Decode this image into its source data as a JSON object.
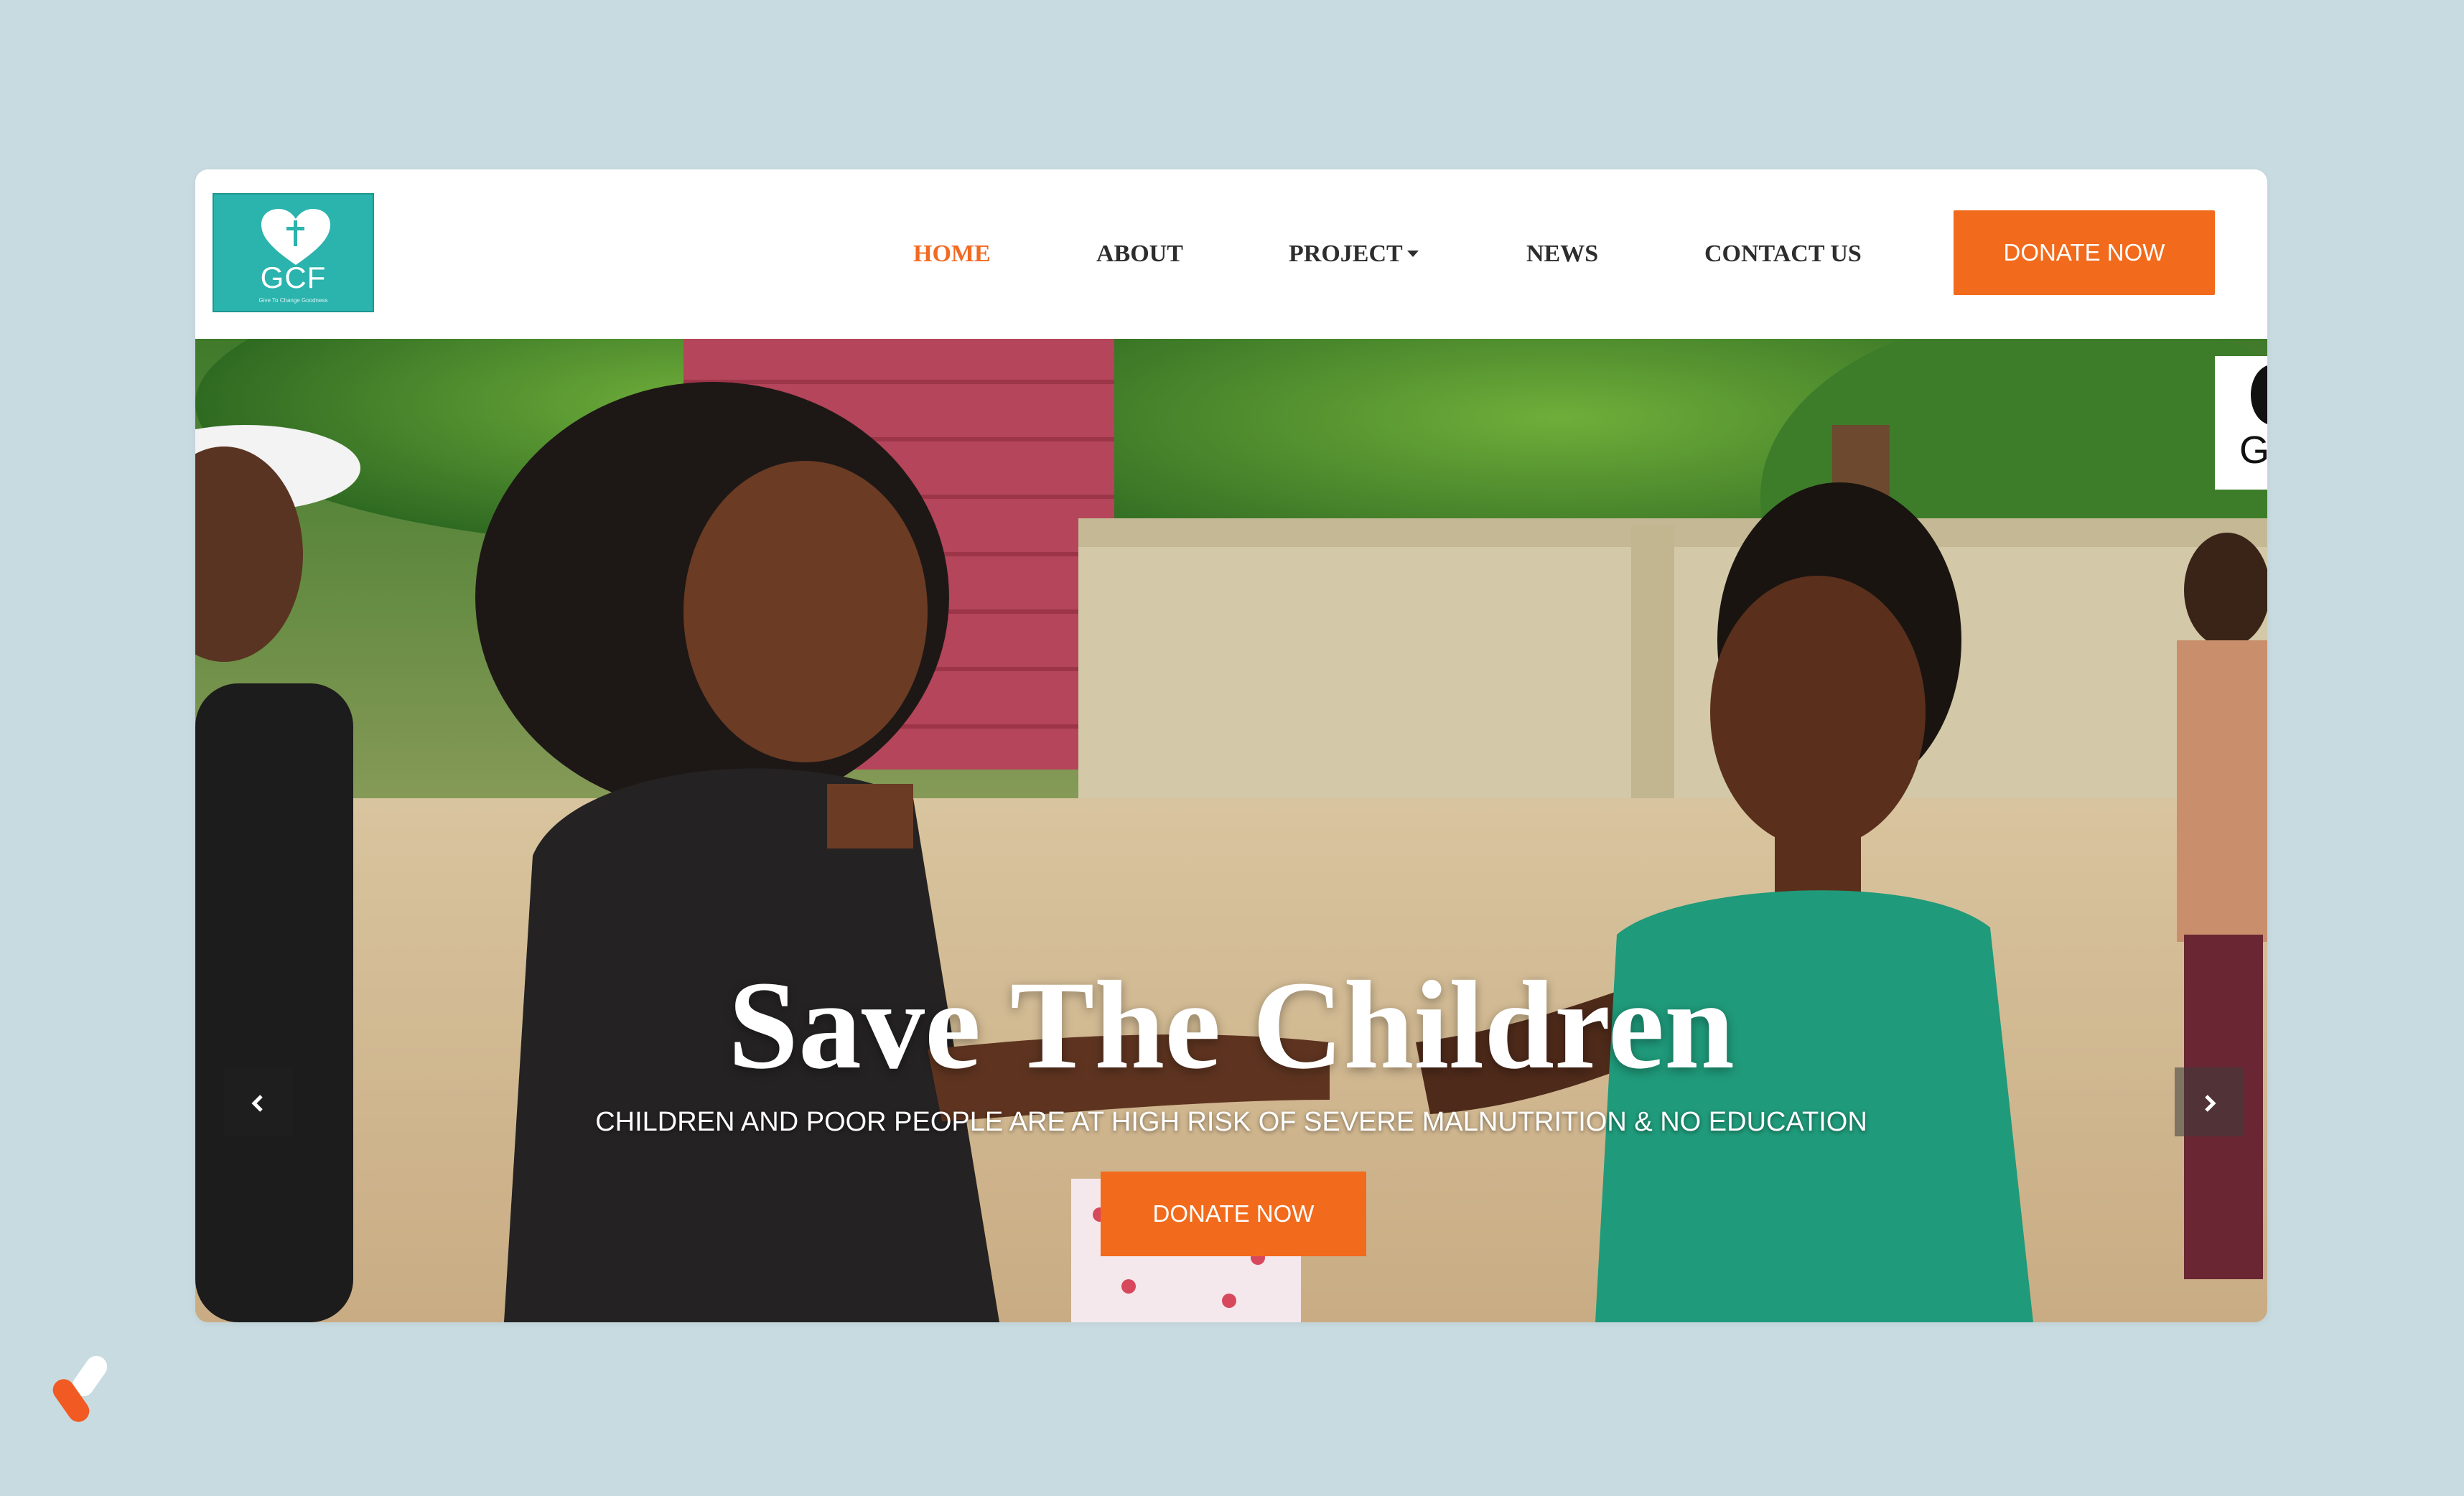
{
  "logo": {
    "text": "GCF",
    "subtext": "Give To Change Goodness",
    "color": "#2bb3ad"
  },
  "nav": {
    "items": [
      {
        "label": "HOME",
        "active": true
      },
      {
        "label": "ABOUT",
        "active": false
      },
      {
        "label": "PROJECT",
        "active": false,
        "dropdown": true
      },
      {
        "label": "NEWS",
        "active": false
      },
      {
        "label": "CONTACT US",
        "active": false
      }
    ],
    "donate_label": "DONATE NOW"
  },
  "hero": {
    "title": "Save The Children",
    "subtitle": "CHILDREN AND POOR PEOPLE ARE AT HIGH RISK OF SEVERE MALNUTRITION & NO EDUCATION",
    "donate_label": "DONATE NOW",
    "prev_icon": "chevron-left-icon",
    "next_icon": "chevron-right-icon",
    "badge_letter": "G"
  },
  "colors": {
    "accent": "#f26a1b",
    "background": "#c8dbe0",
    "brand_teal": "#2bb3ad"
  }
}
